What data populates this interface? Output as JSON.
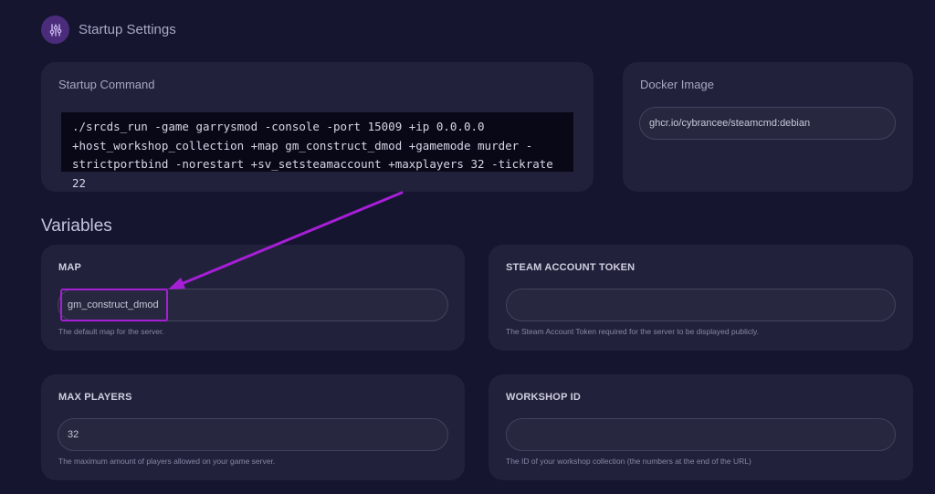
{
  "header": {
    "title": "Startup Settings",
    "icon": "sliders-icon"
  },
  "startup": {
    "title": "Startup Command",
    "command": "./srcds_run -game garrysmod -console -port 15009 +ip 0.0.0.0 +host_workshop_collection +map gm_construct_dmod +gamemode murder -strictportbind -norestart +sv_setsteamaccount +maxplayers 32 -tickrate 22"
  },
  "docker": {
    "title": "Docker Image",
    "value": "ghcr.io/cybrancee/steamcmd:debian"
  },
  "variables": {
    "title": "Variables",
    "map": {
      "label": "MAP",
      "value": "gm_construct_dmod",
      "help": "The default map for the server."
    },
    "steam_token": {
      "label": "STEAM ACCOUNT TOKEN",
      "value": "",
      "help": "The Steam Account Token required for the server to be displayed publicly."
    },
    "max_players": {
      "label": "MAX PLAYERS",
      "value": "32",
      "help": "The maximum amount of players allowed on your game server."
    },
    "workshop_id": {
      "label": "WORKSHOP ID",
      "value": "",
      "help": "The ID of your workshop collection (the numbers at the end of the URL)"
    }
  },
  "colors": {
    "background": "#151530",
    "card": "#21213b",
    "annotation": "#a61fd6"
  }
}
